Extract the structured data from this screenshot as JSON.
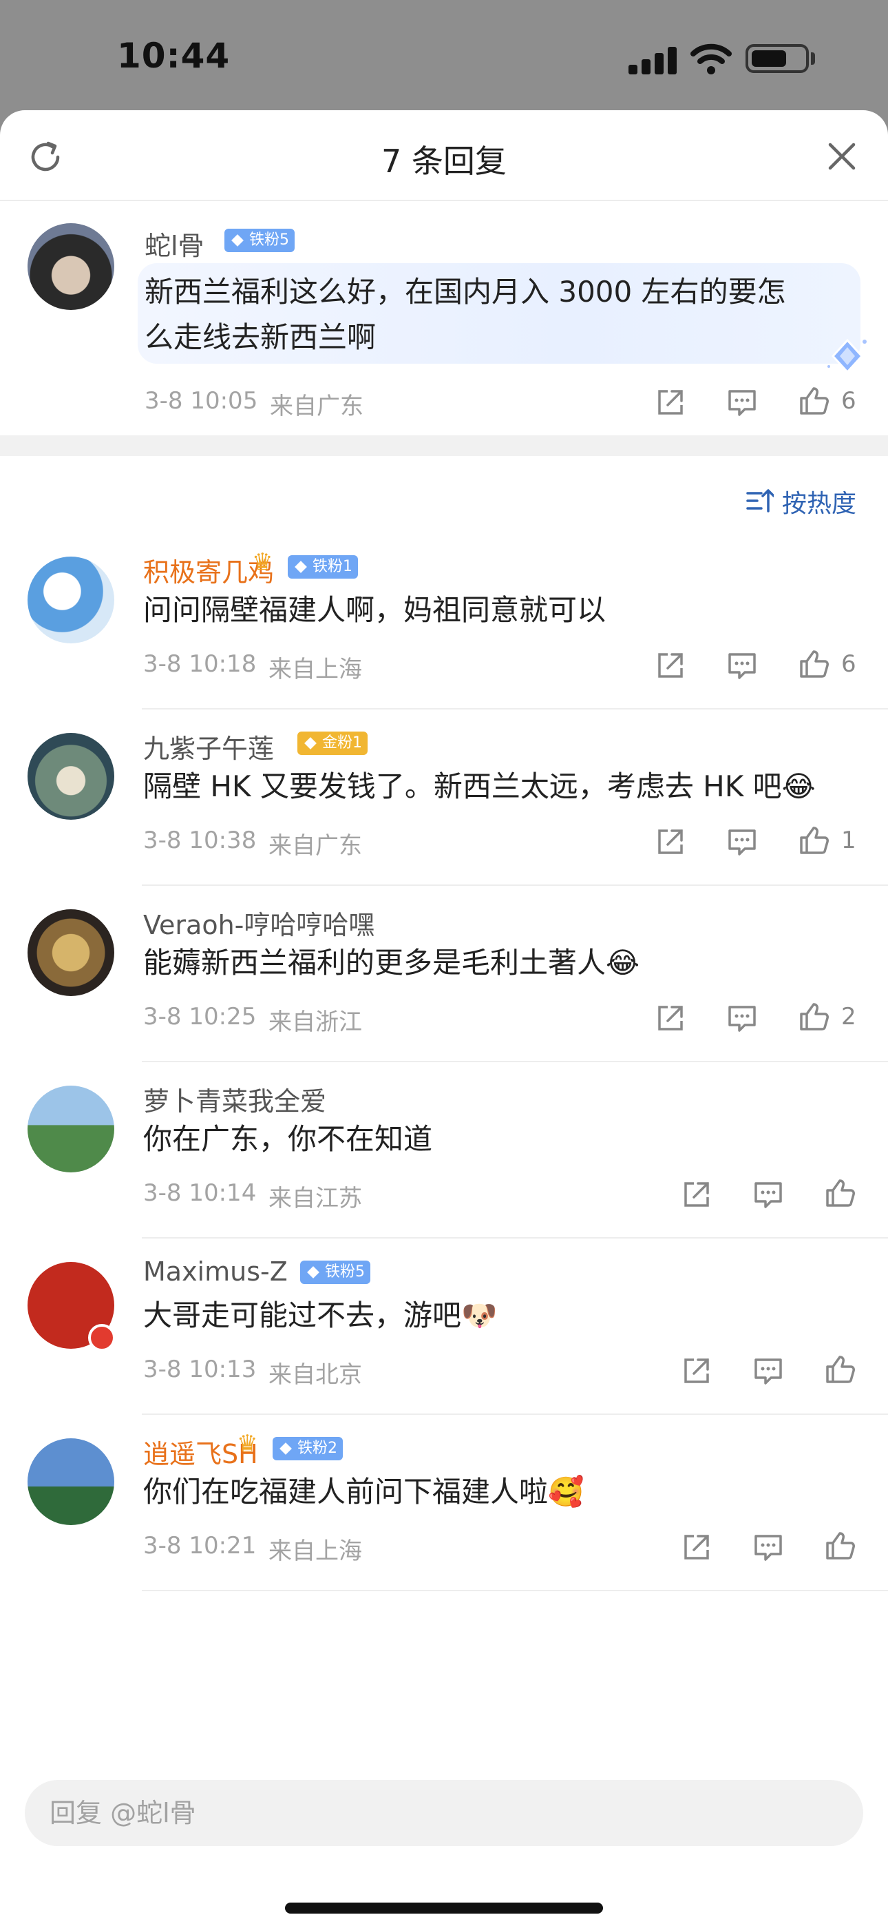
{
  "status_bar": {
    "time": "10:44"
  },
  "header": {
    "title": "7 条回复"
  },
  "original": {
    "user": "蛇l骨",
    "badge": "铁粉5",
    "text_line1": "新西兰福利这么好，在国内月入 3000 左右的要怎",
    "text_line2": "么走线去新西兰啊",
    "time": "3-8 10:05",
    "location": "来自广东",
    "likes": "6"
  },
  "sort": {
    "label": "按热度"
  },
  "replies": [
    {
      "user": "积极寄几鸡",
      "badge": "铁粉1",
      "badge_type": "blue",
      "crown": true,
      "text": "问问隔壁福建人啊，妈祖同意就可以",
      "time": "3-8 10:18",
      "location": "来自上海",
      "likes": "6"
    },
    {
      "user": "九紫子午莲",
      "badge": "金粉1",
      "badge_type": "gold",
      "crown": false,
      "text": "隔壁 HK 又要发钱了。新西兰太远，考虑去 HK 吧😂",
      "time": "3-8 10:38",
      "location": "来自广东",
      "likes": "1"
    },
    {
      "user": "Veraoh-哼哈哼哈嘿",
      "badge": "",
      "badge_type": "",
      "crown": false,
      "text": "能薅新西兰福利的更多是毛利土著人😂",
      "time": "3-8 10:25",
      "location": "来自浙江",
      "likes": "2"
    },
    {
      "user": "萝卜青菜我全爱",
      "badge": "",
      "badge_type": "",
      "crown": false,
      "text": "你在广东，你不在知道",
      "time": "3-8 10:14",
      "location": "来自江苏",
      "likes": ""
    },
    {
      "user": "Maximus-Z",
      "badge": "铁粉5",
      "badge_type": "blue",
      "crown": false,
      "text": "大哥走可能过不去，游吧🐶",
      "time": "3-8 10:13",
      "location": "来自北京",
      "likes": ""
    },
    {
      "user": "逍遥飞SH",
      "badge": "铁粉2",
      "badge_type": "blue",
      "crown": true,
      "text": "你们在吃福建人前问下福建人啦🥰",
      "time": "3-8 10:21",
      "location": "来自上海",
      "likes": ""
    }
  ],
  "input": {
    "placeholder": "回复 @蛇l骨"
  },
  "colors": {
    "accent_blue": "#2f63b3",
    "name_orange": "#e8711a",
    "badge_blue": "#6fa6f5",
    "badge_gold": "#f1b632"
  }
}
